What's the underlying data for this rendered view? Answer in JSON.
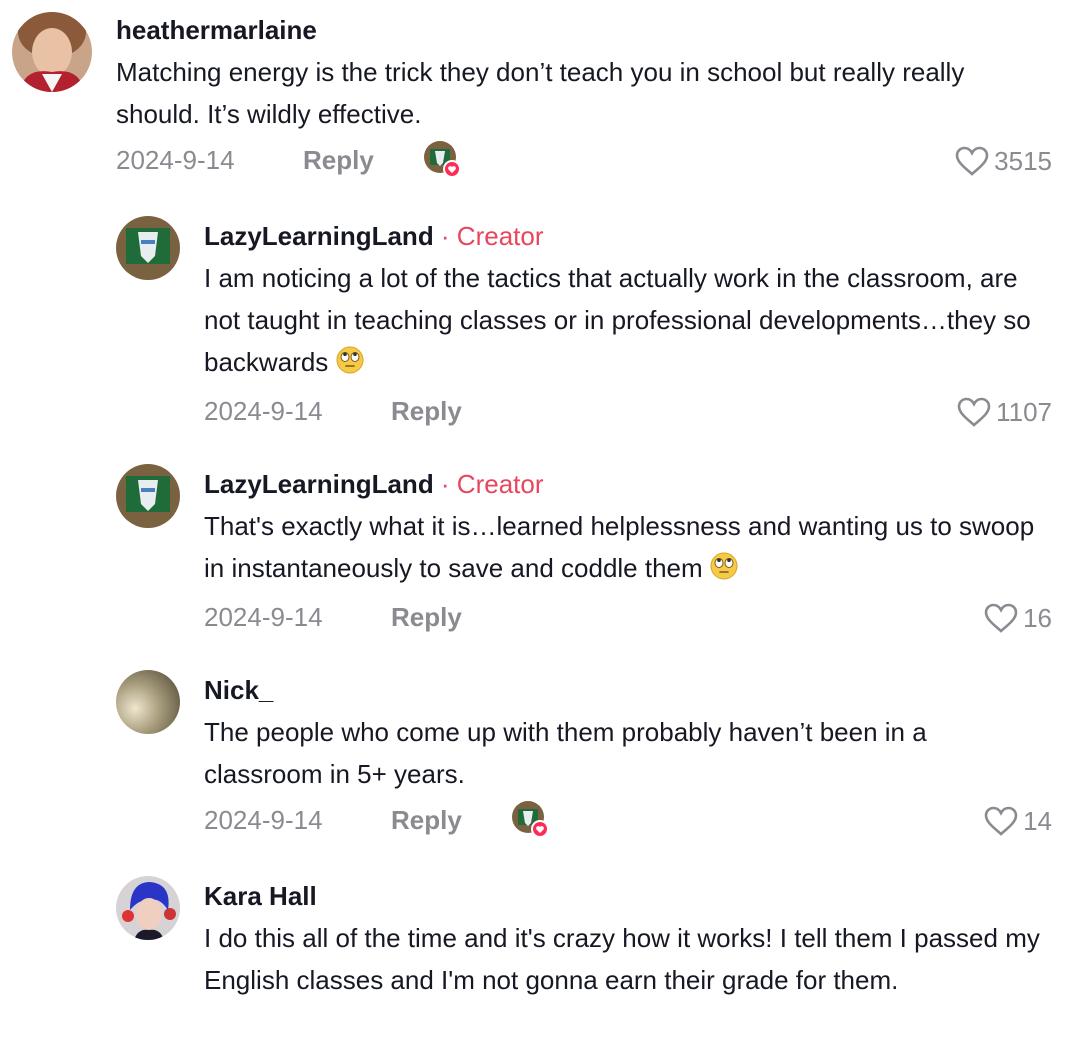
{
  "comments": [
    {
      "username": "heathermarlaine",
      "creator_label": "",
      "text": "Matching energy is the trick they don’t teach you in school but really really should. It’s wildly effective.",
      "date": "2024-9-14",
      "reply": "Reply",
      "likes": "3515",
      "liked_by_creator": true
    },
    {
      "username": "LazyLearningLand",
      "creator_label": " · Creator",
      "text": "I am noticing a lot of the tactics that actually work in the classroom, are not taught in teaching classes or in professional developments…they so backwards",
      "emoji": "🙄",
      "date": "2024-9-14",
      "reply": "Reply",
      "likes": "1107"
    },
    {
      "username": "LazyLearningLand",
      "creator_label": " · Creator",
      "text": "That's exactly what it is…learned helplessness and wanting us to swoop in instantaneously to save and coddle them",
      "emoji": "🙄",
      "date": "2024-9-14",
      "reply": "Reply",
      "likes": "16"
    },
    {
      "username": "Nick_",
      "creator_label": "",
      "text": "The people who come up with them probably haven’t been in a classroom in 5+ years.",
      "date": "2024-9-14",
      "reply": "Reply",
      "likes": "14",
      "liked_by_creator": true
    },
    {
      "username": "Kara Hall",
      "creator_label": "",
      "text": "I do this all of the time and it's crazy how it works! I tell them I passed my English classes and I'm not gonna earn their grade for them."
    }
  ],
  "colors": {
    "creator": "#e8465f",
    "meta": "#8a8b91",
    "text": "#161823",
    "heart_badge": "#fe2c55"
  }
}
